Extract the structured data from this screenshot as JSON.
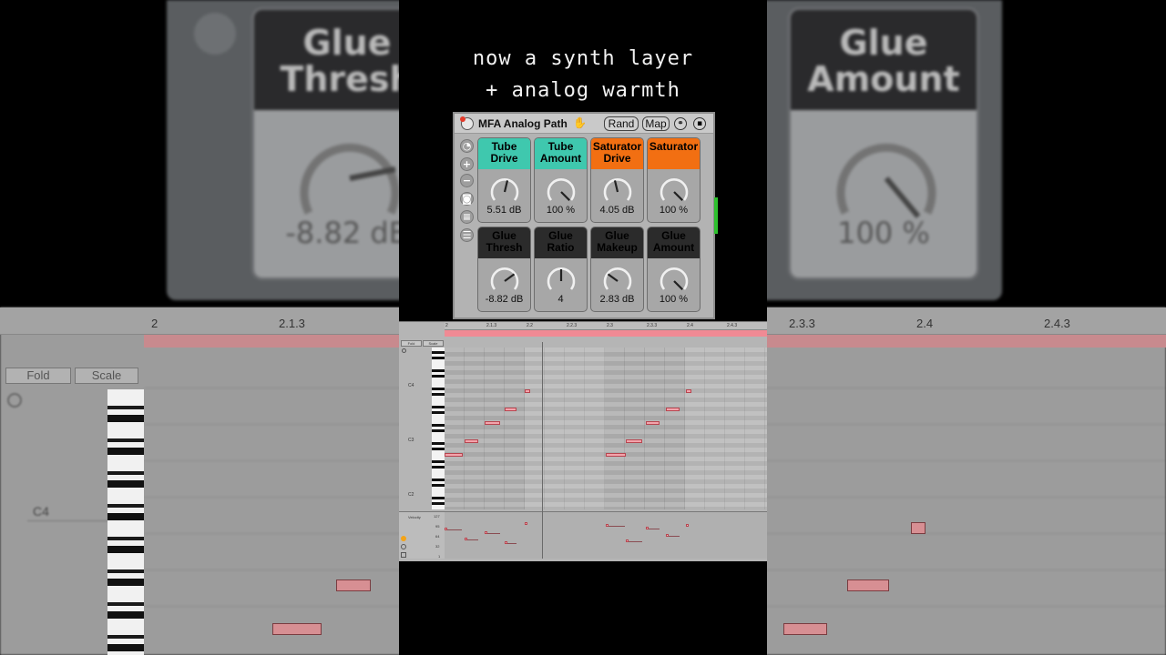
{
  "caption": {
    "line1": "now a synth layer",
    "line2": "+ analog warmth"
  },
  "background": {
    "left_panel": {
      "label": "Glue Thresh",
      "value": "-8.82 dB"
    },
    "right_panel": {
      "label": "Glue Amount",
      "value": "100 %"
    },
    "ruler": [
      "2",
      "2.1.3",
      "2.2",
      "2.2.3",
      "2.3",
      "2.3.3",
      "2.4",
      "2.4.3"
    ],
    "fold_label": "Fold",
    "scale_label": "Scale",
    "key_label": "C4"
  },
  "device": {
    "title": "MFA Analog Path",
    "rand_label": "Rand",
    "map_label": "Map",
    "macros": [
      {
        "label": "Tube Drive",
        "value": "5.51 dB",
        "color": "#3fc8ae",
        "level": 0.55
      },
      {
        "label": "Tube Amount",
        "value": "100 %",
        "color": "#3fc8ae",
        "level": 1.0
      },
      {
        "label": "Saturator Drive",
        "value": "4.05 dB",
        "color": "#f26f12",
        "level": 0.45
      },
      {
        "label": "Saturator",
        "value": "100 %",
        "color": "#f26f12",
        "level": 1.0
      },
      {
        "label": "Glue Thresh",
        "value": "-8.82 dB",
        "color": "#2b2b2b",
        "level": 0.7
      },
      {
        "label": "Glue Ratio",
        "value": "4",
        "color": "#2b2b2b",
        "level": 0.5
      },
      {
        "label": "Glue Makeup",
        "value": "2.83 dB",
        "color": "#2b2b2b",
        "level": 0.3
      },
      {
        "label": "Glue Amount",
        "value": "100 %",
        "color": "#2b2b2b",
        "level": 1.0
      }
    ]
  },
  "piano_roll": {
    "ruler": [
      "2",
      "2.1.3",
      "2.2",
      "2.2.3",
      "2.3",
      "2.3.3",
      "2.4",
      "2.4.3"
    ],
    "fold_label": "Fold",
    "scale_label": "Scale",
    "octaves": [
      "C4",
      "C3",
      "C2"
    ],
    "velocity_label": "Velocity",
    "velocity_ticks": [
      "127",
      "95",
      "64",
      "32",
      "1"
    ]
  }
}
